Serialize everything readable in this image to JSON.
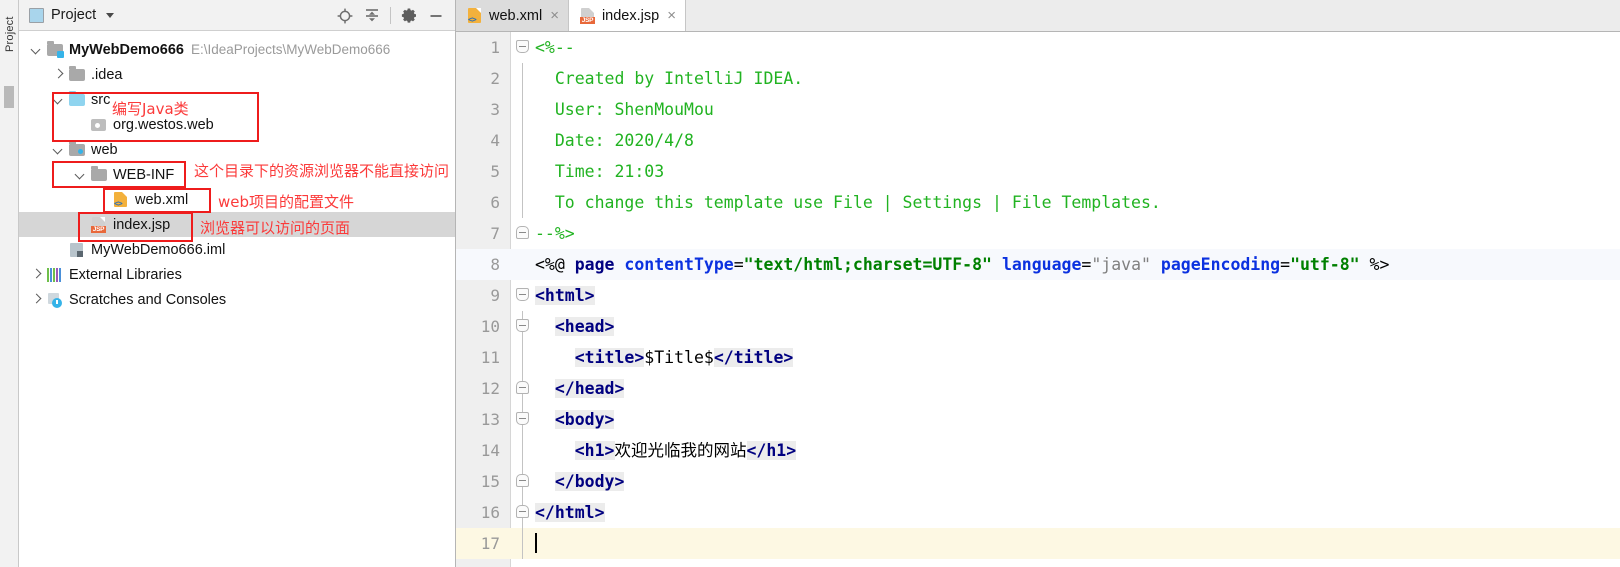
{
  "window": {
    "vertical_strip_label": "Project"
  },
  "project_panel": {
    "title": "Project",
    "icon": "project-window-icon",
    "tools": [
      {
        "name": "locate-icon",
        "title": "Select Opened File"
      },
      {
        "name": "collapse-all-icon",
        "title": "Collapse All"
      },
      {
        "name": "gear-icon",
        "title": "Settings"
      },
      {
        "name": "minimize-icon",
        "title": "Hide"
      }
    ],
    "tree": [
      {
        "label": "MyWebDemo666",
        "path": "E:\\IdeaProjects\\MyWebDemo666",
        "icon": "folder-module-icon",
        "arrow": "down",
        "indent": 0,
        "bold": true,
        "selected": false
      },
      {
        "label": ".idea",
        "path": "",
        "icon": "folder-icon",
        "arrow": "right",
        "indent": 1,
        "bold": false,
        "selected": false
      },
      {
        "label": "src",
        "path": "",
        "icon": "folder-source-icon",
        "arrow": "down",
        "indent": 1,
        "bold": false,
        "selected": false
      },
      {
        "label": "org.westos.web",
        "path": "",
        "icon": "package-icon",
        "arrow": "none",
        "indent": 2,
        "bold": false,
        "selected": false
      },
      {
        "label": "web",
        "path": "",
        "icon": "folder-web-icon",
        "arrow": "down",
        "indent": 1,
        "bold": false,
        "selected": false
      },
      {
        "label": "WEB-INF",
        "path": "",
        "icon": "folder-icon",
        "arrow": "down",
        "indent": 2,
        "bold": false,
        "selected": false
      },
      {
        "label": "web.xml",
        "path": "",
        "icon": "xml-file-icon",
        "arrow": "none",
        "indent": 3,
        "bold": false,
        "selected": false
      },
      {
        "label": "index.jsp",
        "path": "",
        "icon": "jsp-file-icon",
        "arrow": "none",
        "indent": 2,
        "bold": false,
        "selected": true
      },
      {
        "label": "MyWebDemo666.iml",
        "path": "",
        "icon": "iml-file-icon",
        "arrow": "none",
        "indent": 1,
        "bold": false,
        "selected": false
      },
      {
        "label": "External Libraries",
        "path": "",
        "icon": "libraries-icon",
        "arrow": "right",
        "indent": 0,
        "bold": false,
        "selected": false
      },
      {
        "label": "Scratches and Consoles",
        "path": "",
        "icon": "scratches-icon",
        "arrow": "right",
        "indent": 0,
        "bold": false,
        "selected": false
      }
    ]
  },
  "annotations": {
    "color": "#fb3a3a",
    "box_color": "#ee1c1c",
    "items": [
      {
        "name": "annotation-src",
        "text": "编写Java类"
      },
      {
        "name": "annotation-webinf",
        "text": "这个目录下的资源浏览器不能直接访问"
      },
      {
        "name": "annotation-webxml",
        "text": "web项目的配置文件"
      },
      {
        "name": "annotation-indexjsp",
        "text": "浏览器可以访问的页面"
      }
    ]
  },
  "editor": {
    "tabs": [
      {
        "label": "web.xml",
        "icon": "xml-file-icon",
        "active": false,
        "close": "×"
      },
      {
        "label": "index.jsp",
        "icon": "jsp-file-icon",
        "active": true,
        "close": "×"
      }
    ],
    "lines": [
      {
        "no": "1",
        "fold": "open",
        "foldline": false,
        "hl": "none",
        "indent": 0,
        "tokens": [
          {
            "c": "tok-comment",
            "t": "<%--"
          }
        ]
      },
      {
        "no": "2",
        "fold": "none",
        "foldline": true,
        "hl": "none",
        "indent": 0,
        "tokens": [
          {
            "c": "tok-comment",
            "t": "  Created by IntelliJ IDEA."
          }
        ]
      },
      {
        "no": "3",
        "fold": "none",
        "foldline": true,
        "hl": "none",
        "indent": 0,
        "tokens": [
          {
            "c": "tok-comment",
            "t": "  User: ShenMouMou"
          }
        ]
      },
      {
        "no": "4",
        "fold": "none",
        "foldline": true,
        "hl": "none",
        "indent": 0,
        "tokens": [
          {
            "c": "tok-comment",
            "t": "  Date: 2020/4/8"
          }
        ]
      },
      {
        "no": "5",
        "fold": "none",
        "foldline": true,
        "hl": "none",
        "indent": 0,
        "tokens": [
          {
            "c": "tok-comment",
            "t": "  Time: 21:03"
          }
        ]
      },
      {
        "no": "6",
        "fold": "none",
        "foldline": true,
        "hl": "none",
        "indent": 0,
        "tokens": [
          {
            "c": "tok-comment",
            "t": "  To change this template use File | Settings | File Templates."
          }
        ]
      },
      {
        "no": "7",
        "fold": "close",
        "foldline": false,
        "hl": "none",
        "indent": 0,
        "tokens": [
          {
            "c": "tok-comment",
            "t": "--%>"
          }
        ]
      },
      {
        "no": "8",
        "fold": "none",
        "foldline": false,
        "hl": "blue",
        "indent": 0,
        "tokens": [
          {
            "c": "tok-punct",
            "t": "<%@ "
          },
          {
            "c": "tok-tag",
            "t": "page "
          },
          {
            "c": "tok-attr",
            "t": "contentType"
          },
          {
            "c": "tok-punct",
            "t": "="
          },
          {
            "c": "tok-str",
            "t": "\"text/html;charset=UTF-8\""
          },
          {
            "c": "tok-punct",
            "t": " "
          },
          {
            "c": "tok-attr",
            "t": "language"
          },
          {
            "c": "tok-punct",
            "t": "="
          },
          {
            "c": "tok-str-gray",
            "t": "\"java\""
          },
          {
            "c": "tok-punct",
            "t": " "
          },
          {
            "c": "tok-attr",
            "t": "pageEncoding"
          },
          {
            "c": "tok-punct",
            "t": "="
          },
          {
            "c": "tok-str",
            "t": "\"utf-8\""
          },
          {
            "c": "tok-punct",
            "t": " %>"
          }
        ]
      },
      {
        "no": "9",
        "fold": "open",
        "foldline": false,
        "hl": "none",
        "indent": 0,
        "tokens": [
          {
            "c": "tok-tag hl-tag",
            "t": "<html>"
          }
        ]
      },
      {
        "no": "10",
        "fold": "open",
        "foldline": true,
        "hl": "none",
        "indent": 0,
        "tokens": [
          {
            "c": "tok-plain",
            "t": "  "
          },
          {
            "c": "tok-tag hl-tag",
            "t": "<head>"
          }
        ]
      },
      {
        "no": "11",
        "fold": "none",
        "foldline": true,
        "hl": "none",
        "indent": 0,
        "tokens": [
          {
            "c": "tok-plain",
            "t": "    "
          },
          {
            "c": "tok-tag hl-tag",
            "t": "<title>"
          },
          {
            "c": "tok-plain",
            "t": "$Title$"
          },
          {
            "c": "tok-tag hl-tag",
            "t": "</title>"
          }
        ]
      },
      {
        "no": "12",
        "fold": "close",
        "foldline": true,
        "hl": "none",
        "indent": 0,
        "tokens": [
          {
            "c": "tok-plain",
            "t": "  "
          },
          {
            "c": "tok-tag hl-tag",
            "t": "</head>"
          }
        ]
      },
      {
        "no": "13",
        "fold": "open",
        "foldline": true,
        "hl": "none",
        "indent": 0,
        "tokens": [
          {
            "c": "tok-plain",
            "t": "  "
          },
          {
            "c": "tok-tag hl-tag",
            "t": "<body>"
          }
        ]
      },
      {
        "no": "14",
        "fold": "none",
        "foldline": true,
        "hl": "none",
        "indent": 0,
        "tokens": [
          {
            "c": "tok-plain",
            "t": "    "
          },
          {
            "c": "tok-tag hl-tag",
            "t": "<h1>"
          },
          {
            "c": "tok-zh",
            "t": "欢迎光临我的网站"
          },
          {
            "c": "tok-tag hl-tag",
            "t": "</h1>"
          }
        ]
      },
      {
        "no": "15",
        "fold": "close",
        "foldline": true,
        "hl": "none",
        "indent": 0,
        "tokens": [
          {
            "c": "tok-plain",
            "t": "  "
          },
          {
            "c": "tok-tag hl-tag",
            "t": "</body>"
          }
        ]
      },
      {
        "no": "16",
        "fold": "close",
        "foldline": true,
        "hl": "none",
        "indent": 0,
        "tokens": [
          {
            "c": "tok-tag hl-tag",
            "t": "</html>"
          }
        ]
      },
      {
        "no": "17",
        "fold": "none",
        "foldline": true,
        "hl": "caret",
        "indent": 0,
        "caret": true,
        "tokens": []
      }
    ]
  }
}
